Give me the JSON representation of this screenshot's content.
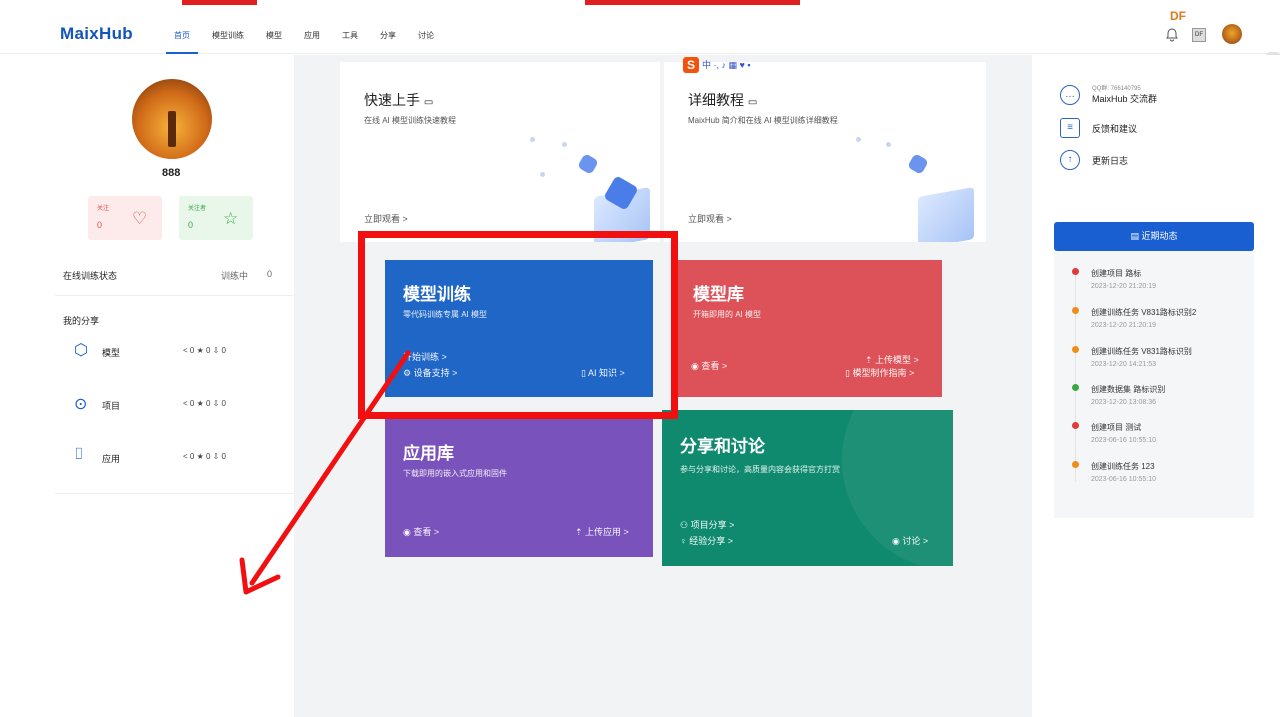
{
  "topbar": {
    "logo": "MaixHub",
    "nav": [
      "首页",
      "模型训练",
      "模型",
      "应用",
      "工具",
      "分享",
      "讨论"
    ],
    "df_label": "DF"
  },
  "profile": {
    "username": "888",
    "follow": {
      "label": "关注",
      "count": "0"
    },
    "followers": {
      "label": "关注者",
      "count": "0"
    },
    "train_status_label": "在线训练状态",
    "training_label": "训练中",
    "training_count": "0",
    "my_share_label": "我的分享",
    "shares": [
      {
        "label": "模型",
        "stats": "< 0  ★ 0  ⇩ 0"
      },
      {
        "label": "项目",
        "stats": "< 0  ★ 0  ⇩ 0"
      },
      {
        "label": "应用",
        "stats": "< 0  ★ 0  ⇩ 0"
      }
    ]
  },
  "tutorials": [
    {
      "title": "快速上手",
      "subtitle": "在线 AI 模型训练快速教程",
      "link": "立即观看 >"
    },
    {
      "title": "详细教程",
      "subtitle": "MaixHub 简介和在线 AI 模型训练详细教程",
      "link": "立即观看 >"
    }
  ],
  "tiles": {
    "train": {
      "title": "模型训练",
      "subtitle": "零代码训练专属 AI 模型",
      "start": "开始训练 >",
      "device": "设备支持 >",
      "ai": "AI 知识 >"
    },
    "model": {
      "title": "模型库",
      "subtitle": "开箱即用的 AI 模型",
      "view": "查看 >",
      "upload": "上传模型 >",
      "guide": "模型制作指南 >"
    },
    "app": {
      "title": "应用库",
      "subtitle": "下载即用的嵌入式应用和固件",
      "view": "查看 >",
      "upload": "上传应用 >"
    },
    "share": {
      "title": "分享和讨论",
      "subtitle": "参与分享和讨论，高质量内容会获得官方打赏",
      "project": "项目分享 >",
      "exp": "经验分享 >",
      "discuss": "讨论 >"
    }
  },
  "right": {
    "qq": "QQ群: 766140795",
    "group": "MaixHub 交流群",
    "feedback": "反馈和建议",
    "changelog": "更新日志",
    "activity_btn": "近期动态",
    "activities": [
      {
        "title": "创建项目 路标",
        "date": "2023-12-20 21:20:19",
        "color": "#e03a3a"
      },
      {
        "title": "创建训练任务 V831路标识别2",
        "date": "2023-12-20 21:20:19",
        "color": "#f08c1a"
      },
      {
        "title": "创建训练任务 V831路标识别",
        "date": "2023-12-20 14:21:53",
        "color": "#f08c1a"
      },
      {
        "title": "创建数据集 路标识别",
        "date": "2023-12-20 13:08:36",
        "color": "#3aa845"
      },
      {
        "title": "创建项目 测试",
        "date": "2023-06-16 10:55:10",
        "color": "#e03a3a"
      },
      {
        "title": "创建训练任务 123",
        "date": "2023-06-16 10:55:10",
        "color": "#f08c1a"
      }
    ]
  }
}
